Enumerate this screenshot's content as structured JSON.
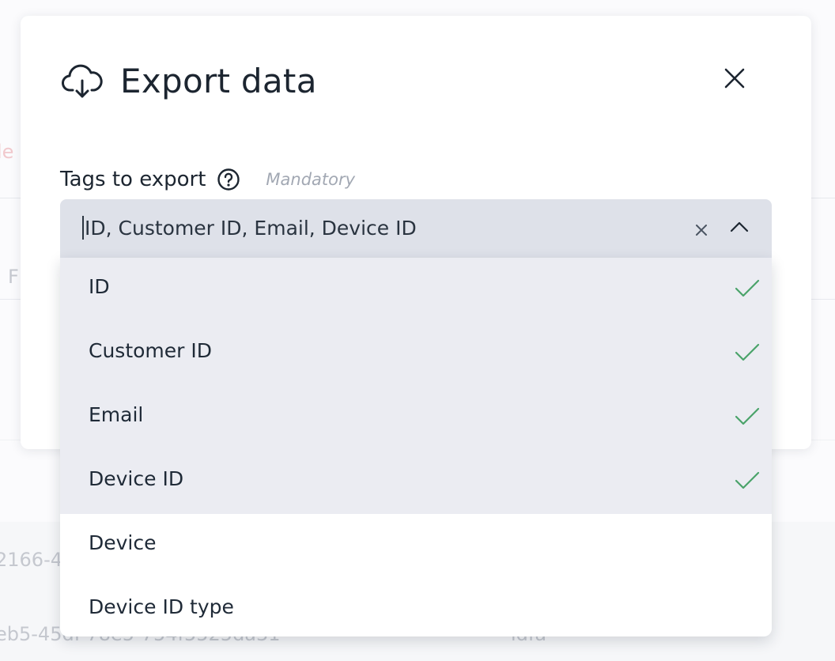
{
  "background": {
    "fragments": [
      "le",
      "F",
      "2166-4",
      "eb5-45df-78e5-754f5525da31",
      "idfa"
    ]
  },
  "modal": {
    "title": "Export data",
    "cloud_icon": "cloud-download-icon",
    "close_icon": "close-icon"
  },
  "field": {
    "label": "Tags to export",
    "help_icon": "question-circle-icon",
    "mandatory": "Mandatory"
  },
  "select": {
    "value": "ID, Customer ID, Email, Device ID",
    "clear_icon": "clear-icon",
    "toggle_icon": "chevron-up-icon"
  },
  "options": [
    {
      "label": "ID",
      "selected": true
    },
    {
      "label": "Customer ID",
      "selected": true
    },
    {
      "label": "Email",
      "selected": true
    },
    {
      "label": "Device ID",
      "selected": true
    },
    {
      "label": "Device",
      "selected": false
    },
    {
      "label": "Device ID type",
      "selected": false
    }
  ],
  "colors": {
    "check": "#4aa36a",
    "select_bg": "#dee1e9",
    "selected_option_bg": "#ebecf2",
    "mandatory_text": "#a2a8b3"
  }
}
